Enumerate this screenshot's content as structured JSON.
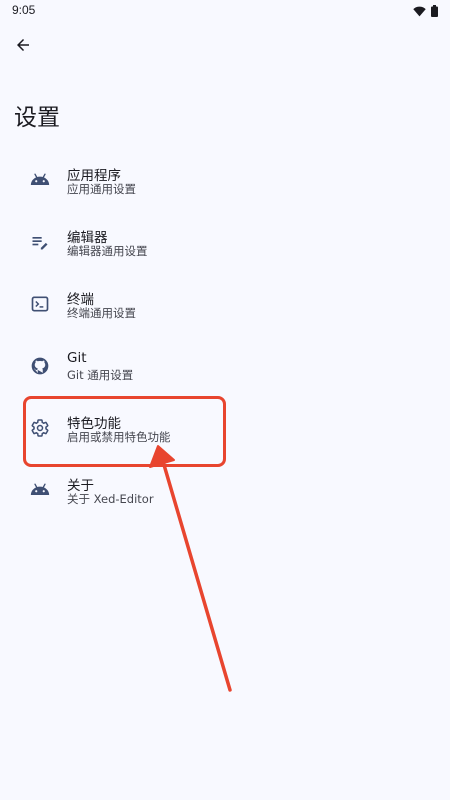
{
  "status_bar": {
    "time": "9:05",
    "icons": [
      "wifi-icon",
      "battery-icon"
    ]
  },
  "header": {
    "back_icon": "arrow-left-icon",
    "title": "设置"
  },
  "settings": {
    "items": [
      {
        "id": "app",
        "icon": "android-icon",
        "title": "应用程序",
        "subtitle": "应用通用设置"
      },
      {
        "id": "editor",
        "icon": "edit-note-icon",
        "title": "编辑器",
        "subtitle": "编辑器通用设置"
      },
      {
        "id": "terminal",
        "icon": "terminal-icon",
        "title": "终端",
        "subtitle": "终端通用设置"
      },
      {
        "id": "git",
        "icon": "github-icon",
        "title": "Git",
        "subtitle": "Git 通用设置"
      },
      {
        "id": "features",
        "icon": "gear-icon",
        "title": "特色功能",
        "subtitle": "启用或禁用特色功能"
      },
      {
        "id": "about",
        "icon": "android-icon",
        "title": "关于",
        "subtitle": "关于 Xed-Editor"
      }
    ]
  },
  "annotation": {
    "color": "#e8452f",
    "highlighted_item": "features"
  },
  "colors": {
    "background": "#f8f9ff",
    "icon": "#3f4f73",
    "text_primary": "#1b1b21",
    "text_secondary": "#45464f"
  }
}
